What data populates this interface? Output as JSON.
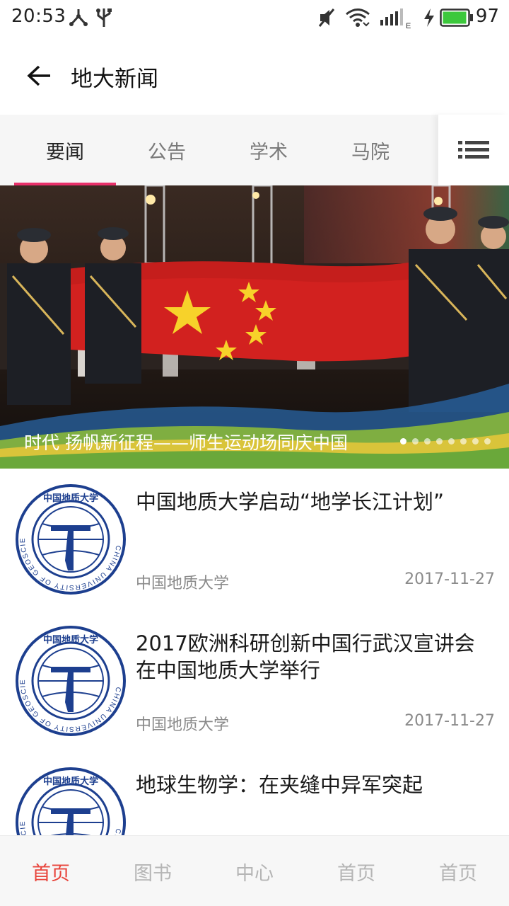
{
  "status_bar": {
    "time": "20:53",
    "battery_percent": "97",
    "battery_level": 0.97,
    "network_type": "E",
    "battery_color": "#3cc83c",
    "icons": [
      "usb-tether-icon",
      "usb-icon",
      "mute-icon",
      "wifi-icon",
      "signal-icon",
      "charging-icon",
      "battery-icon"
    ]
  },
  "header": {
    "title": "地大新闻",
    "back_icon": "arrow-left-icon"
  },
  "tabs": {
    "items": [
      {
        "label": "要闻",
        "active": true
      },
      {
        "label": "公告",
        "active": false
      },
      {
        "label": "学术",
        "active": false
      },
      {
        "label": "马院",
        "active": false
      }
    ],
    "menu_icon": "list-menu-icon",
    "indicator_color": "#e8306a"
  },
  "banner": {
    "caption": "时代 扬帆新征程——师生运动场同庆中国",
    "slide_count": 8,
    "active_index": 0
  },
  "news": [
    {
      "title": "中国地质大学启动“地学长江计划”",
      "source": "中国地质大学",
      "date": "2017-11-27",
      "thumb_logo_text": "CHINA UNIVERSITY OF GEOSCIENCES",
      "thumb_logo_cn": "中国地质大学"
    },
    {
      "title": "2017欧洲科研创新中国行武汉宣讲会在中国地质大学举行",
      "source": "中国地质大学",
      "date": "2017-11-27",
      "thumb_logo_text": "CHINA UNIVERSITY OF GEOSCIENCES",
      "thumb_logo_cn": "中国地质大学"
    },
    {
      "title": "地球生物学：在夹缝中异军突起",
      "source": "",
      "date": "",
      "thumb_logo_text": "CHINA UNIVERSITY OF GEOSCIENCES",
      "thumb_logo_cn": "中国地质大学"
    }
  ],
  "bottom_nav": {
    "items": [
      {
        "label": "首页",
        "active": true
      },
      {
        "label": "图书",
        "active": false
      },
      {
        "label": "中心",
        "active": false
      },
      {
        "label": "首页",
        "active": false
      },
      {
        "label": "首页",
        "active": false
      }
    ],
    "active_color": "#e8453c"
  }
}
